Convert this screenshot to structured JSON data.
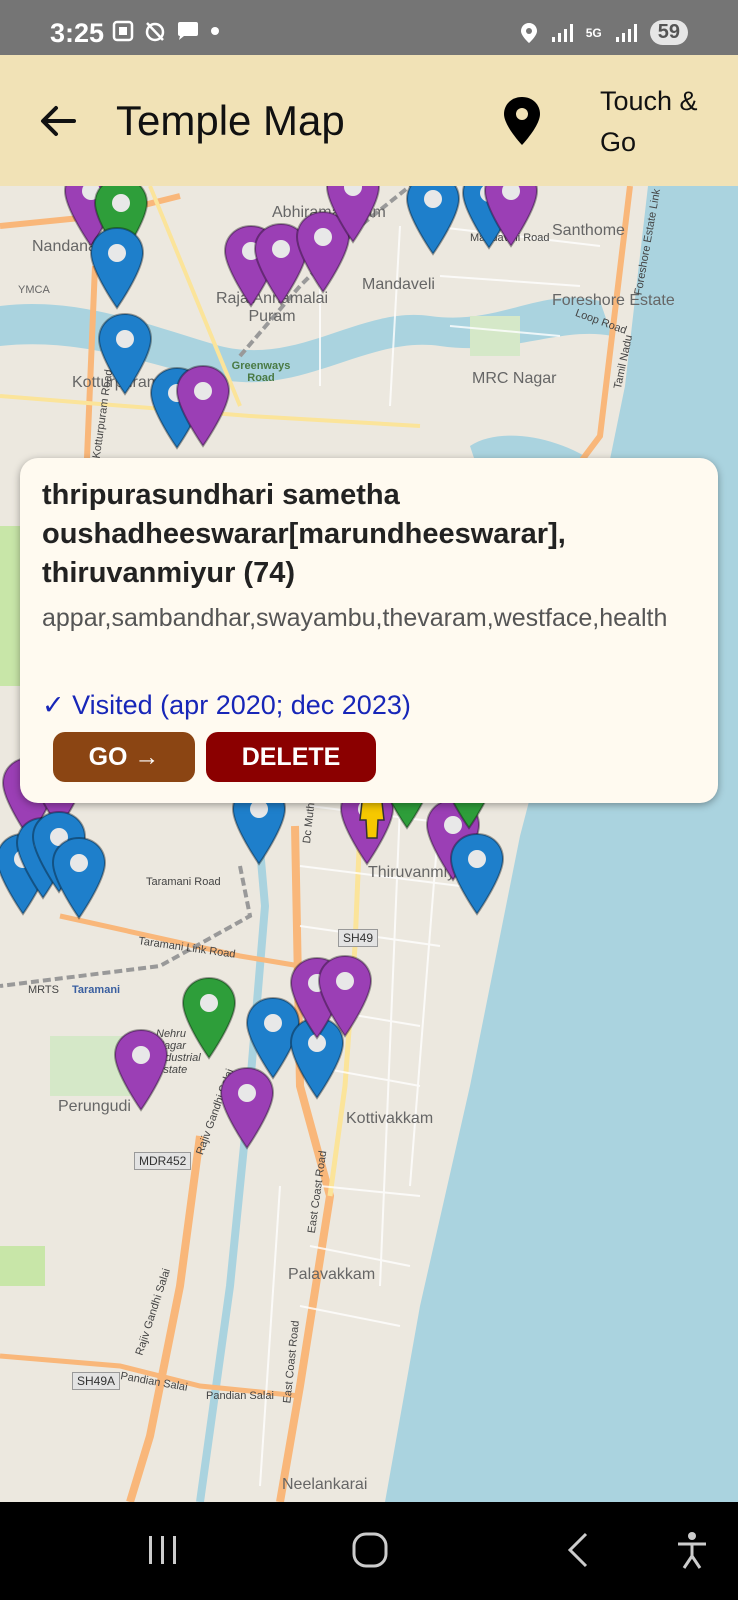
{
  "status": {
    "time": "3:25",
    "battery": "59",
    "network": "5G"
  },
  "app_bar": {
    "title": "Temple Map",
    "touch_go": "Touch & Go",
    "icons": [
      "back-arrow-icon",
      "map-pin-icon"
    ]
  },
  "map": {
    "labels": {
      "abhirama": "Abhiramapuram",
      "santhome": "Santhome",
      "nandanam": "Nandanam",
      "ymca": "YMCA",
      "mandaveli": "Mandaveli",
      "rajaannamalai": "Raja Annamalai Puram",
      "foreshore": "Foreshore Estate",
      "mrc": "MRC Nagar",
      "kotturpuram": "Kotturpuram",
      "greenways": "Greenways Road",
      "thiruvanmiyur": "Thiruvanmiyur",
      "taramani": "Taramani",
      "perungudi": "Perungudi",
      "kottivakkam": "Kottivakkam",
      "palavakkam": "Palavakkam",
      "neelankarai": "Neelankarai",
      "nehru": "Nehru Nagar Industrial Estate"
    },
    "roads": {
      "mandaveli_road": "Mandaveli Road",
      "loop_road": "Loop Road",
      "foreshore_link": "Foreshore Estate Link",
      "tamil_nadu": "Tamil Nadu",
      "taramani_road": "Taramani Road",
      "taramani_link": "Taramani Link Road",
      "mrts": "MRTS",
      "rajiv_gandhi": "Rajiv Gandhi Salai",
      "rajiv_gandhi_2": "Rajiv Gandhi Salai",
      "ecr": "East Coast Road",
      "ecr_2": "East Coast Road",
      "pandian": "Pandian Salai",
      "pandian_2": "Pandian Salai",
      "dc_muthu": "Dc Muthu",
      "kotturpuram_road": "Kotturpuram Road"
    },
    "shields": {
      "sh49": "SH49",
      "mdr452": "MDR452",
      "sh49a": "SH49A"
    },
    "colors": {
      "sea": "#aad3df",
      "land": "#ece8df",
      "marker_blue": "#1e7fcb",
      "marker_purple": "#9b3fb5",
      "marker_green": "#2e9e3a"
    }
  },
  "popup": {
    "title": "thripurasundhari sametha oushadheeswarar[marundheeswarar], thiruvanmiyur (74)",
    "tags": "appar,sambandhar,swayambu,thevaram,westface,health",
    "visited": "✓ Visited (apr 2020; dec 2023)",
    "go_label": "GO →",
    "delete_label": "DELETE"
  }
}
